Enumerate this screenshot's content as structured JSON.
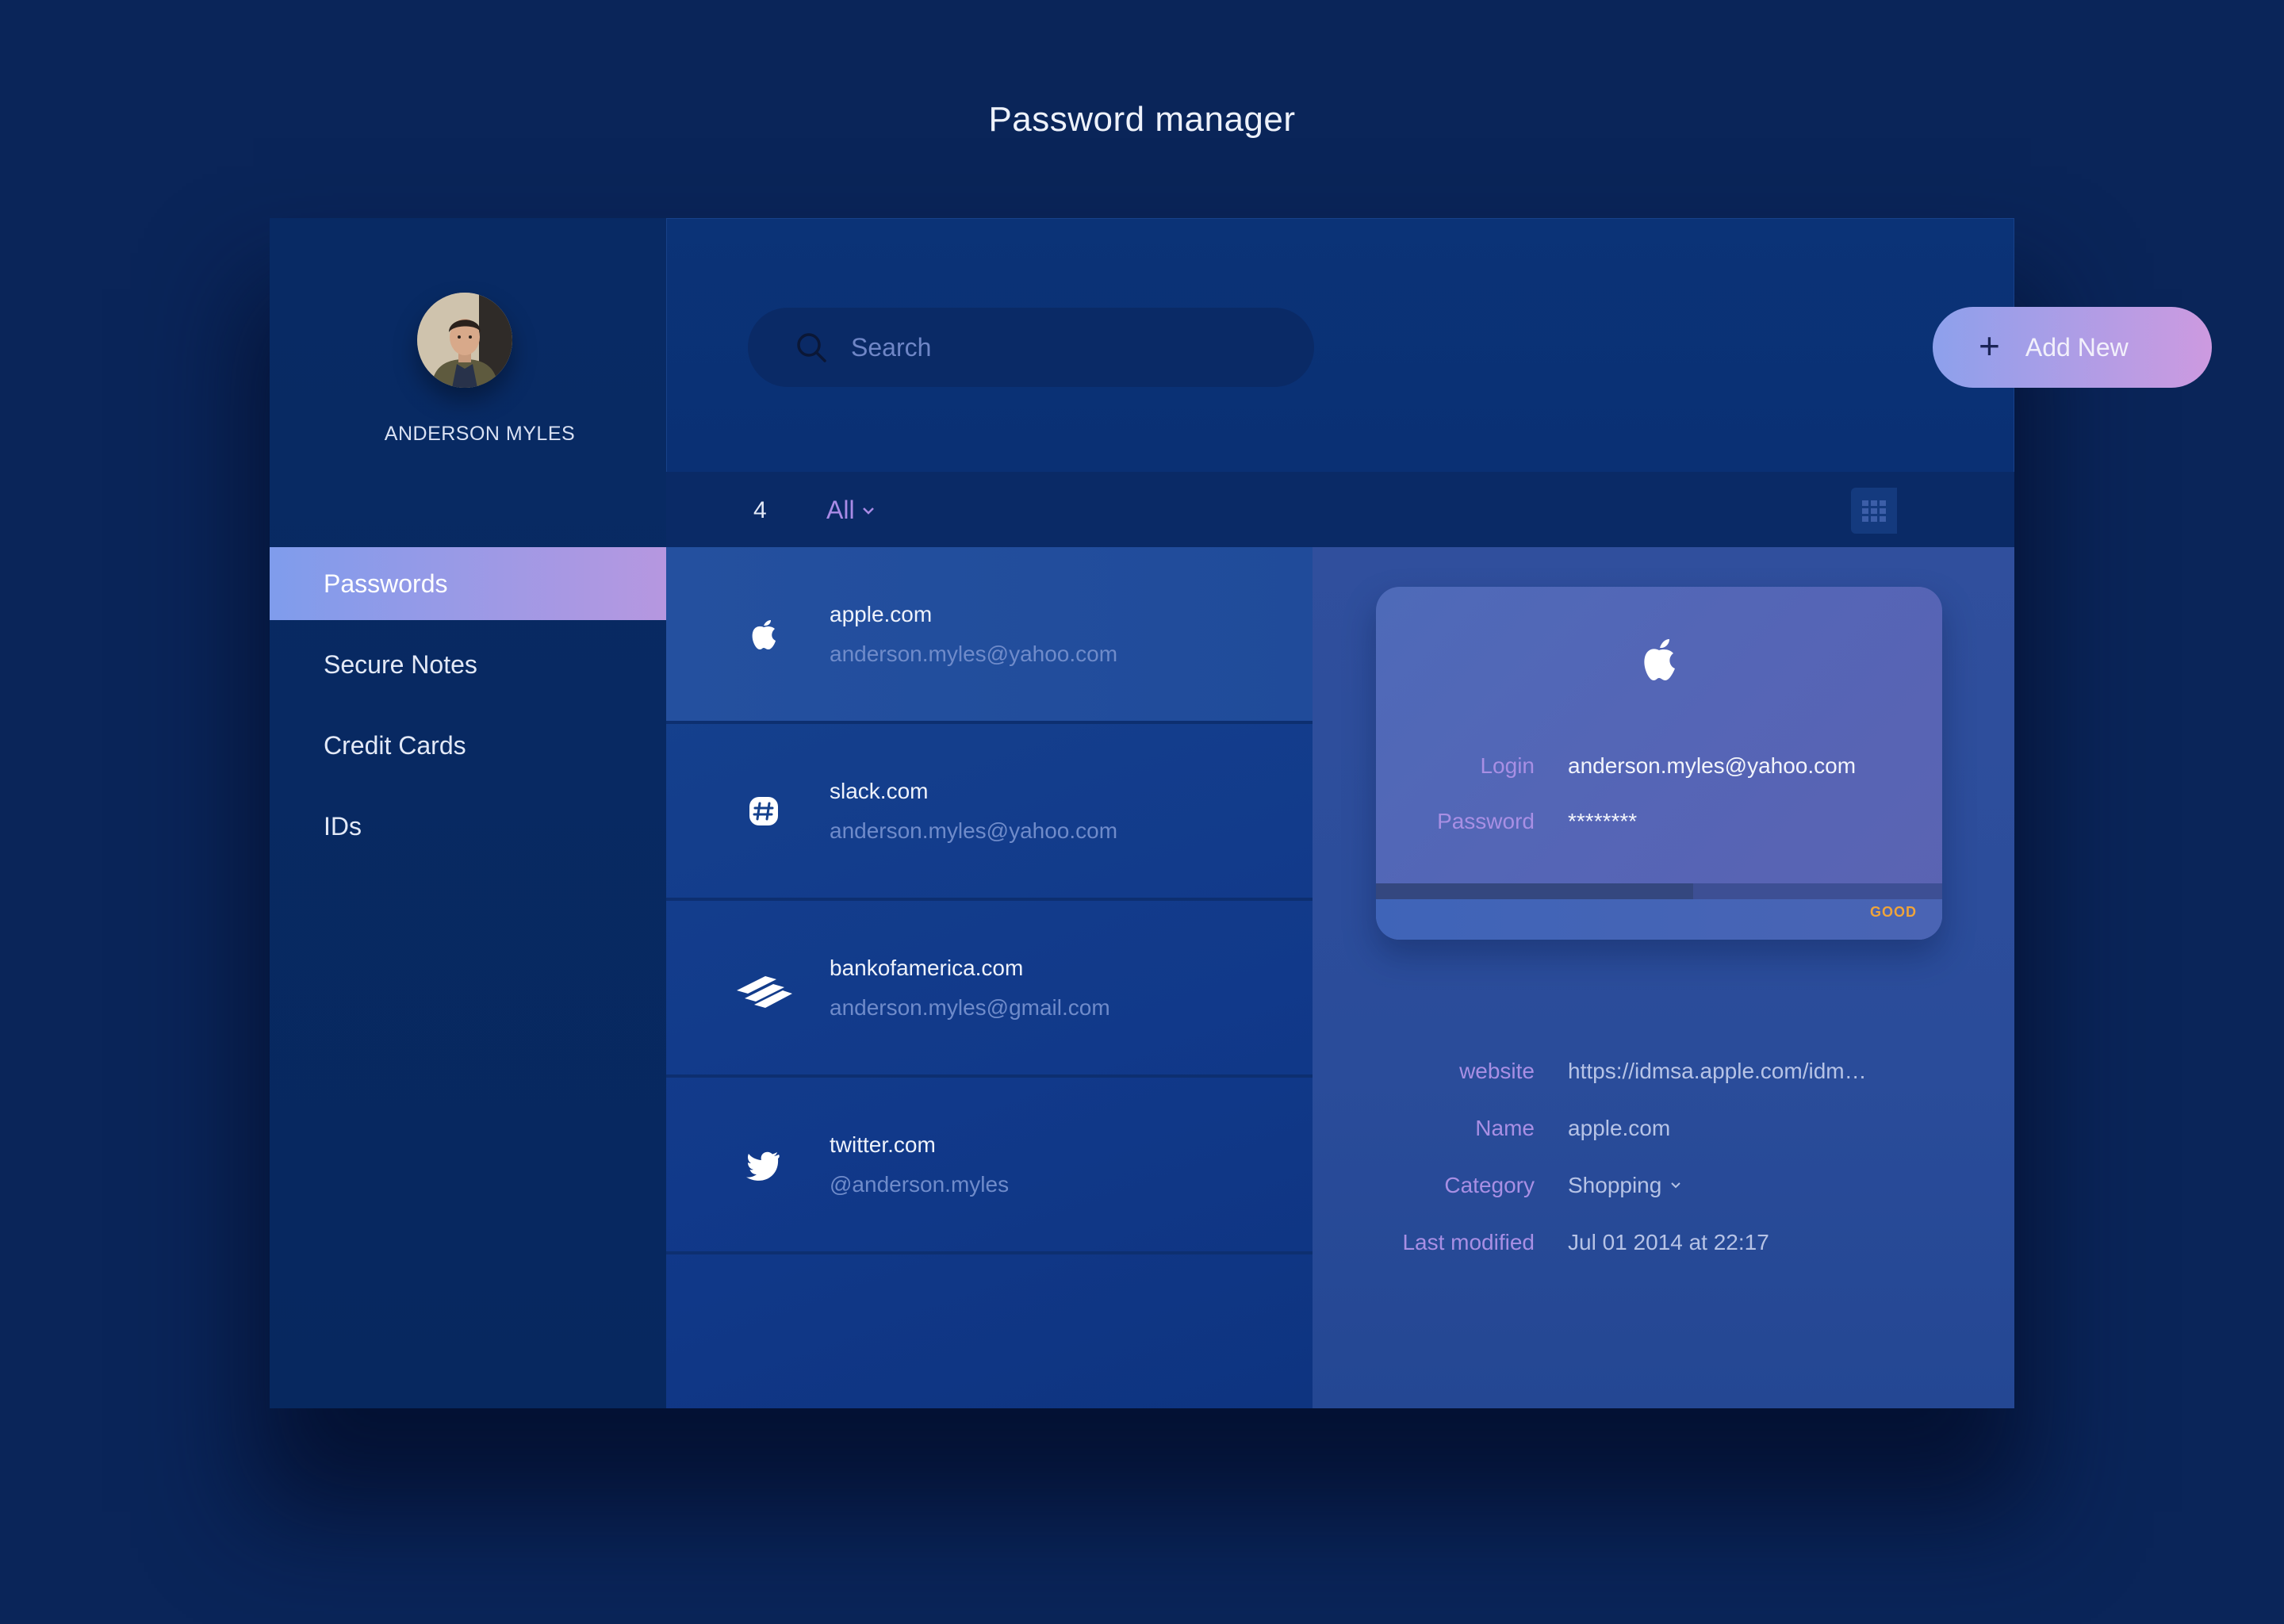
{
  "page": {
    "title": "Password manager"
  },
  "colors": {
    "background": "#0a2559",
    "accent_start": "#7f9cec",
    "accent_end": "#cd9ae0",
    "label_purple": "#a88fe4",
    "strength_good": "#f0a43a"
  },
  "user": {
    "name": "ANDERSON MYLES",
    "avatar_icon": "user-avatar-photo"
  },
  "sidebar": {
    "items": [
      {
        "label": "Passwords",
        "active": true
      },
      {
        "label": "Secure Notes",
        "active": false
      },
      {
        "label": "Credit Cards",
        "active": false
      },
      {
        "label": "IDs",
        "active": false
      }
    ]
  },
  "header": {
    "search": {
      "placeholder": "Search",
      "value": "",
      "icon": "search-icon"
    },
    "add_button": {
      "label": "Add New",
      "icon": "plus-icon"
    }
  },
  "toolbar": {
    "count": "4",
    "filter": {
      "selected": "All",
      "icon": "chevron-down-icon"
    },
    "view_modes": [
      "grid-view-icon",
      "list-view-icon"
    ],
    "active_view": "list"
  },
  "list": {
    "items": [
      {
        "site": "apple.com",
        "username": "anderson.myles@yahoo.com",
        "icon": "apple-icon",
        "selected": true
      },
      {
        "site": "slack.com",
        "username": "anderson.myles@yahoo.com",
        "icon": "slack-icon",
        "selected": false
      },
      {
        "site": "bankofamerica.com",
        "username": "anderson.myles@gmail.com",
        "icon": "bankofamerica-icon",
        "selected": false
      },
      {
        "site": "twitter.com",
        "username": "@anderson.myles",
        "icon": "twitter-icon",
        "selected": false
      }
    ]
  },
  "detail": {
    "card": {
      "icon": "apple-icon",
      "login_label": "Login",
      "login_value": "anderson.myles@yahoo.com",
      "password_label": "Password",
      "password_value": "********",
      "strength_label": "GOOD",
      "strength_level": 0.56
    },
    "meta": [
      {
        "label": "website",
        "value": "https://idmsa.apple.com/idm…"
      },
      {
        "label": "Name",
        "value": "apple.com"
      },
      {
        "label": "Category",
        "value": "Shopping"
      },
      {
        "label": "Last modified",
        "value": "Jul 01 2014 at 22:17"
      }
    ]
  }
}
